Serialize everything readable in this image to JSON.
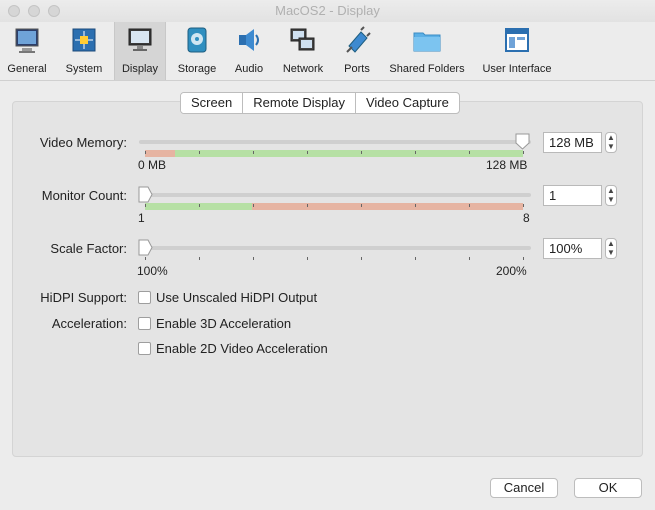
{
  "window": {
    "title": "MacOS2 - Display"
  },
  "toolbar": {
    "items": [
      {
        "label": "General",
        "icon": "monitor-icon"
      },
      {
        "label": "System",
        "icon": "chip-icon"
      },
      {
        "label": "Display",
        "icon": "display-icon"
      },
      {
        "label": "Storage",
        "icon": "disk-icon"
      },
      {
        "label": "Audio",
        "icon": "speaker-icon"
      },
      {
        "label": "Network",
        "icon": "network-icon"
      },
      {
        "label": "Ports",
        "icon": "plug-icon"
      },
      {
        "label": "Shared Folders",
        "icon": "folder-icon"
      },
      {
        "label": "User Interface",
        "icon": "window-icon"
      }
    ],
    "selected": "Display"
  },
  "tabs": [
    "Screen",
    "Remote Display",
    "Video Capture"
  ],
  "active_tab": "Screen",
  "settings": {
    "video_memory": {
      "label": "Video Memory:",
      "value": "128 MB",
      "min_label": "0 MB",
      "max_label": "128 MB",
      "level": 1.0
    },
    "monitor_count": {
      "label": "Monitor Count:",
      "value": "1",
      "min_label": "1",
      "max_label": "8",
      "level": 0.0
    },
    "scale_factor": {
      "label": "Scale Factor:",
      "value": "100%",
      "min_label": "100%",
      "max_label": "200%",
      "level": 0.0
    },
    "hidpi": {
      "label": "HiDPI Support:",
      "option": "Use Unscaled HiDPI Output",
      "checked": false
    },
    "acceleration": {
      "label": "Acceleration:",
      "option_3d": "Enable 3D Acceleration",
      "checked_3d": false,
      "option_2d": "Enable 2D Video Acceleration",
      "checked_2d": false
    }
  },
  "buttons": {
    "cancel": "Cancel",
    "ok": "OK"
  },
  "colors": {
    "range_ok": "#b6e0a4",
    "range_warn": "#e6b4a2"
  }
}
